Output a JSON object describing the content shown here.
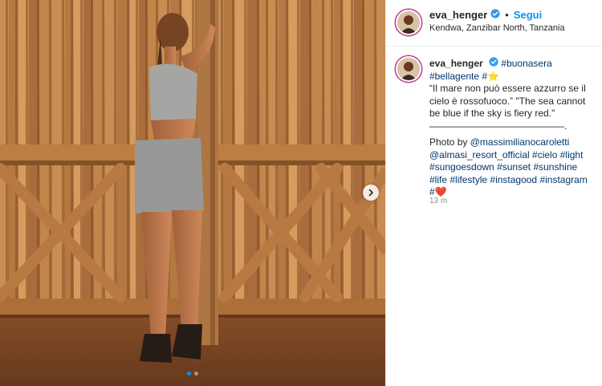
{
  "post": {
    "username": "eva_henger",
    "follow_label": "Segui",
    "separator": "•",
    "location": "Kendwa, Zanzibar North, Tanzania"
  },
  "caption": {
    "username": "eva_henger",
    "line1_tag": "#buonasera",
    "line2_tag": "#bellagente",
    "line2_tag2": "#",
    "line2_emoji": "⭐",
    "quote_lines": [
      "“Il mare non può essere azzurro se il",
      "cielo è rossofuoco.” \"The sea cannot",
      "be blue if the sky is fiery red.\"",
      "——————————————."
    ],
    "photo_by": "Photo by",
    "credits": [
      "@massimilianocaroletti",
      "@almasi_resort_official",
      "#cielo",
      "#light",
      "#sungoesdown",
      "#sunset",
      "#sunshine",
      "#life",
      "#lifestyle",
      "#instagood",
      "#instagram",
      "#"
    ],
    "heart": "❤️",
    "time": "13 m"
  },
  "carousel": {
    "current": 1,
    "total": 2
  },
  "icons": {
    "verified": "verified-badge-icon",
    "next": "chevron-right-icon"
  },
  "colors": {
    "link": "#00376b",
    "follow": "#0095f6",
    "verified": "#3897f0",
    "story_ring": "#c73b8f",
    "text": "#262626",
    "muted": "#8e8e8e"
  }
}
